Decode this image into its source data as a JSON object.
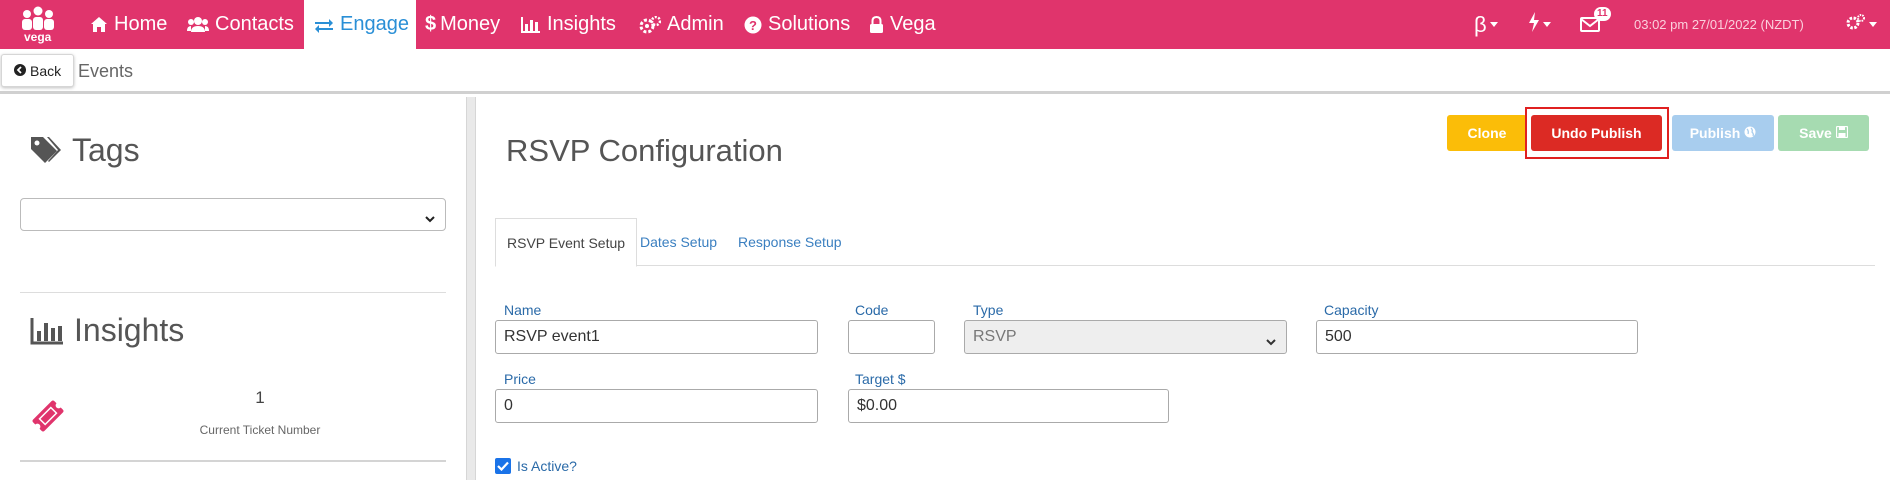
{
  "nav": {
    "logo_text": "vega",
    "items": [
      {
        "label": "Home",
        "icon": "home-icon"
      },
      {
        "label": "Contacts",
        "icon": "users-icon"
      },
      {
        "label": "Engage",
        "icon": "exchange-icon"
      },
      {
        "label": "Money",
        "icon": "dollar-icon"
      },
      {
        "label": "Insights",
        "icon": "bar-chart-icon"
      },
      {
        "label": "Admin",
        "icon": "cogs-icon"
      },
      {
        "label": "Solutions",
        "icon": "question-circle-icon"
      },
      {
        "label": "Vega",
        "icon": "lock-icon"
      }
    ],
    "active_index": 2,
    "beta_label": "β",
    "notification_count": "11",
    "timestamp": "03:02 pm 27/01/2022 (NZDT)"
  },
  "subbar": {
    "back_label": "Back",
    "breadcrumb": "Events"
  },
  "sidebar": {
    "tags_heading": "Tags",
    "insights_heading": "Insights",
    "ticket_number": "1",
    "ticket_label": "Current Ticket Number"
  },
  "main": {
    "title": "RSVP Configuration",
    "buttons": {
      "clone": "Clone",
      "undo_publish": "Undo Publish",
      "publish": "Publish",
      "save": "Save"
    },
    "tabs": [
      "RSVP Event Setup",
      "Dates Setup",
      "Response Setup"
    ],
    "active_tab": 0,
    "fields": {
      "name_label": "Name",
      "name_value": "RSVP event1",
      "code_label": "Code",
      "code_value": "",
      "type_label": "Type",
      "type_value": "RSVP",
      "capacity_label": "Capacity",
      "capacity_value": "500",
      "price_label": "Price",
      "price_value": "0",
      "target_label": "Target $",
      "target_value": "$0.00"
    },
    "is_active_label": "Is Active?",
    "is_active_checked": true
  },
  "colors": {
    "brand": "#e0346c",
    "active_link": "#2a8fd6",
    "clone": "#fbbd08",
    "undo_publish": "#dc2a24",
    "publish": "#a8cdee",
    "save": "#a6dbb1"
  }
}
